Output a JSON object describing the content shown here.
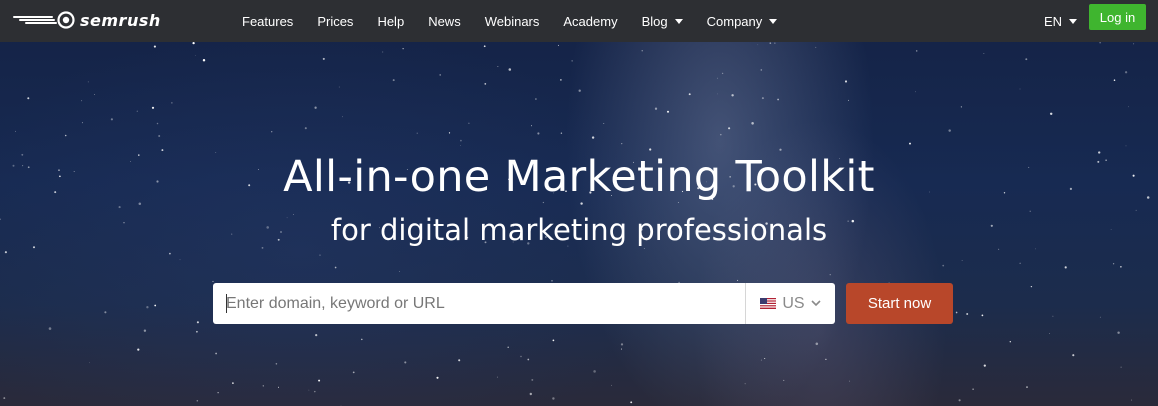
{
  "brand": {
    "logo_text": "semrush",
    "logo_icon": "semrush-fireball-icon"
  },
  "nav": {
    "items": [
      {
        "label": "Features"
      },
      {
        "label": "Prices"
      },
      {
        "label": "Help"
      },
      {
        "label": "News"
      },
      {
        "label": "Webinars"
      },
      {
        "label": "Academy"
      },
      {
        "label": "Blog",
        "has_dropdown": true
      },
      {
        "label": "Company",
        "has_dropdown": true
      }
    ],
    "language": "EN",
    "login_label": "Log in"
  },
  "hero": {
    "title": "All-in-one Marketing Toolkit",
    "subtitle": "for digital marketing professionals",
    "search": {
      "placeholder": "Enter domain, keyword or URL",
      "value": "",
      "database": {
        "flag_icon": "us-flag-icon",
        "label": "US"
      },
      "submit_label": "Start now"
    }
  },
  "colors": {
    "topbar_bg": "#2d2f33",
    "login_green": "#3fb52f",
    "start_button": "#b8472a",
    "sky": "#172a52"
  }
}
